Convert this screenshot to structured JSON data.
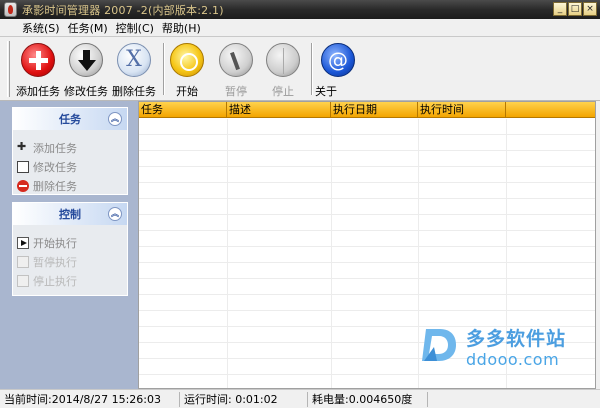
{
  "window": {
    "title": "承影时间管理器 2007 -2(内部版本:2.1)",
    "buttons": [
      "0",
      "1",
      "r"
    ]
  },
  "menu": [
    "系统(S)",
    "任务(M)",
    "控制(C)",
    "帮助(H)"
  ],
  "toolbar": {
    "add": "添加任务",
    "edit": "修改任务",
    "delete": "删除任务",
    "start": "开始",
    "pause": "暂停",
    "stop": "停止",
    "about": "关于"
  },
  "panel": {
    "tasks_group": {
      "title": "任务",
      "items": [
        "添加任务",
        "修改任务",
        "删除任务"
      ]
    },
    "control_group": {
      "title": "控制",
      "items": [
        "开始执行",
        "暂停执行",
        "停止执行"
      ]
    }
  },
  "table": {
    "columns": [
      "任务",
      "描述",
      "执行日期",
      "执行时间",
      ""
    ]
  },
  "watermark": {
    "top": "多多软件站",
    "bottom": "ddooo.com"
  },
  "status": {
    "current_time": "当前时间:2014/8/27 15:26:03",
    "run_time": "运行时间: 0:01:02",
    "power": "耗电量:0.004650度"
  }
}
